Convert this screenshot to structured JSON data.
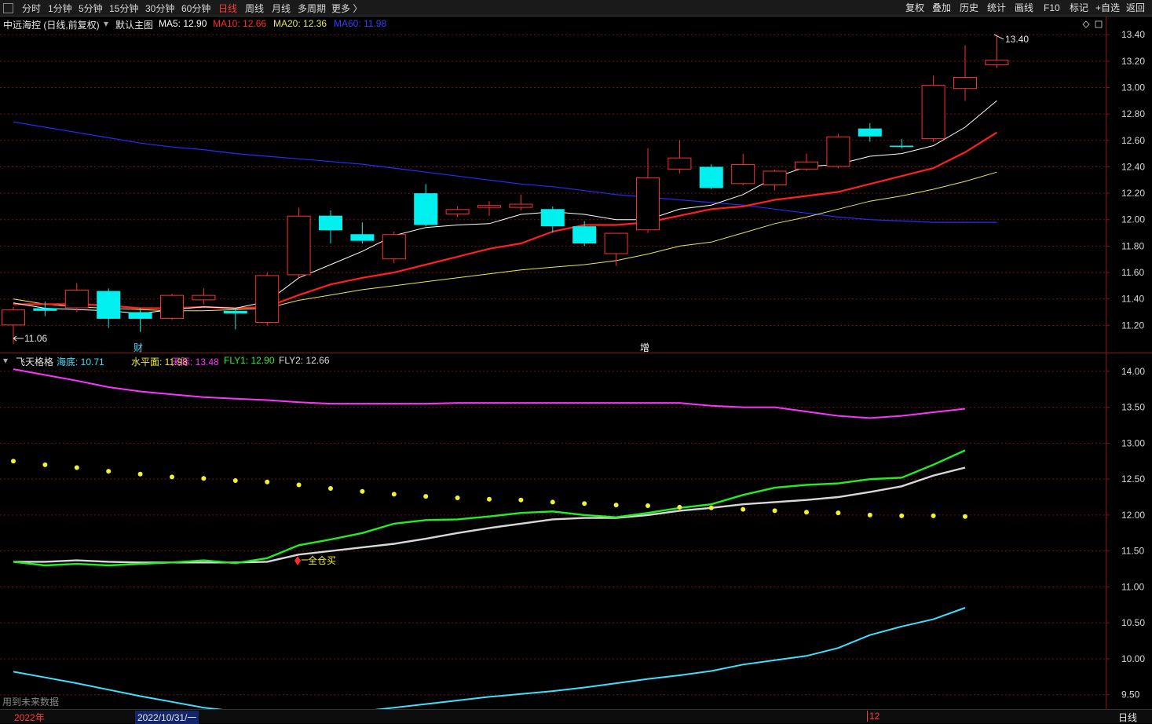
{
  "toolbar": {
    "periods": [
      "分时",
      "1分钟",
      "5分钟",
      "15分钟",
      "30分钟",
      "60分钟",
      "日线",
      "周线",
      "月线",
      "多周期",
      "更多 〉"
    ],
    "active_period": "日线",
    "right_buttons": [
      "复权",
      "叠加",
      "历史",
      "统计",
      "画线",
      "F10",
      "标记",
      "+自选",
      "返回"
    ]
  },
  "main_chart": {
    "stock_title": "中远海控 (日线,前复权)",
    "template_label": "默认主图",
    "ma": [
      {
        "label": "MA5: 12.90",
        "color": "#ffffff"
      },
      {
        "label": "MA10: 12.66",
        "color": "#ff2a2a"
      },
      {
        "label": "MA20: 12.36",
        "color": "#e8e85a"
      },
      {
        "label": "MA60: 11.98",
        "color": "#3b3bff"
      }
    ],
    "y_ticks": [
      "13.40",
      "13.20",
      "13.00",
      "12.80",
      "12.60",
      "12.40",
      "12.20",
      "12.00",
      "11.80",
      "11.60",
      "11.40",
      "11.20"
    ],
    "high_label": "13.40",
    "low_label": "11.06",
    "event_tags": [
      "财",
      "增"
    ]
  },
  "indicator_panel": {
    "name": "飞天格格",
    "values": [
      {
        "label": "海底: 10.71",
        "color": "#3ee0ff"
      },
      {
        "label": "水平面: 11.98",
        "color": "#f2f230"
      },
      {
        "label": "天际: 13.48",
        "color": "#ff33ff"
      },
      {
        "label": "FLY1: 12.90",
        "color": "#33ee33"
      },
      {
        "label": "FLY2: 12.66",
        "color": "#dddddd"
      }
    ],
    "y_ticks": [
      "14.00",
      "13.50",
      "13.00",
      "12.50",
      "12.00",
      "11.50",
      "11.00",
      "10.50",
      "10.00",
      "9.50"
    ],
    "signal_label": "全仓买",
    "footnote": "用到未来数据"
  },
  "bottom_bar": {
    "year": "2022年",
    "date_cursor": "2022/10/31/一",
    "month_mark": "12",
    "period": "日线"
  },
  "chart_data": {
    "type": "candlestick",
    "price_range": [
      11.06,
      13.4
    ],
    "candles": [
      {
        "o": 11.2,
        "c": 11.32,
        "h": 11.34,
        "l": 11.06
      },
      {
        "o": 11.33,
        "c": 11.31,
        "h": 11.38,
        "l": 11.27
      },
      {
        "o": 11.33,
        "c": 11.47,
        "h": 11.52,
        "l": 11.3
      },
      {
        "o": 11.46,
        "c": 11.25,
        "h": 11.48,
        "l": 11.18
      },
      {
        "o": 11.3,
        "c": 11.25,
        "h": 11.33,
        "l": 11.15
      },
      {
        "o": 11.25,
        "c": 11.43,
        "h": 11.44,
        "l": 11.24
      },
      {
        "o": 11.39,
        "c": 11.43,
        "h": 11.48,
        "l": 11.36
      },
      {
        "o": 11.31,
        "c": 11.29,
        "h": 11.33,
        "l": 11.17
      },
      {
        "o": 11.22,
        "c": 11.58,
        "h": 11.6,
        "l": 11.2
      },
      {
        "o": 11.58,
        "c": 12.03,
        "h": 12.09,
        "l": 11.56
      },
      {
        "o": 12.03,
        "c": 11.92,
        "h": 12.07,
        "l": 11.82
      },
      {
        "o": 11.89,
        "c": 11.84,
        "h": 11.98,
        "l": 11.82
      },
      {
        "o": 11.7,
        "c": 11.89,
        "h": 11.91,
        "l": 11.67
      },
      {
        "o": 12.2,
        "c": 11.96,
        "h": 12.27,
        "l": 11.95
      },
      {
        "o": 12.04,
        "c": 12.08,
        "h": 12.1,
        "l": 12.02
      },
      {
        "o": 12.09,
        "c": 12.11,
        "h": 12.14,
        "l": 12.03
      },
      {
        "o": 12.09,
        "c": 12.12,
        "h": 12.19,
        "l": 12.07
      },
      {
        "o": 12.08,
        "c": 11.95,
        "h": 12.1,
        "l": 11.9
      },
      {
        "o": 11.95,
        "c": 11.82,
        "h": 11.99,
        "l": 11.8
      },
      {
        "o": 11.74,
        "c": 11.9,
        "h": 11.9,
        "l": 11.65
      },
      {
        "o": 11.92,
        "c": 12.32,
        "h": 12.54,
        "l": 11.9
      },
      {
        "o": 12.38,
        "c": 12.47,
        "h": 12.6,
        "l": 12.35
      },
      {
        "o": 12.4,
        "c": 12.24,
        "h": 12.42,
        "l": 12.23
      },
      {
        "o": 12.27,
        "c": 12.42,
        "h": 12.5,
        "l": 12.26
      },
      {
        "o": 12.26,
        "c": 12.37,
        "h": 12.38,
        "l": 12.22
      },
      {
        "o": 12.38,
        "c": 12.44,
        "h": 12.5,
        "l": 12.37
      },
      {
        "o": 12.4,
        "c": 12.63,
        "h": 12.65,
        "l": 12.39
      },
      {
        "o": 12.69,
        "c": 12.63,
        "h": 12.73,
        "l": 12.59
      },
      {
        "o": 12.56,
        "c": 12.55,
        "h": 12.61,
        "l": 12.54
      },
      {
        "o": 12.61,
        "c": 13.02,
        "h": 13.09,
        "l": 12.59
      },
      {
        "o": 12.99,
        "c": 13.08,
        "h": 13.32,
        "l": 12.9
      },
      {
        "o": 13.17,
        "c": 13.21,
        "h": 13.4,
        "l": 13.15
      }
    ],
    "ma5": [
      11.37,
      11.33,
      11.32,
      11.31,
      11.29,
      11.32,
      11.34,
      11.33,
      11.38,
      11.56,
      11.66,
      11.76,
      11.88,
      11.94,
      11.96,
      11.97,
      12.04,
      12.06,
      12.04,
      12.0,
      12.0,
      12.08,
      12.11,
      12.19,
      12.32,
      12.4,
      12.42,
      12.48,
      12.5,
      12.56,
      12.7,
      12.9
    ],
    "ma10": [
      11.36,
      11.36,
      11.36,
      11.35,
      11.33,
      11.33,
      11.34,
      11.33,
      11.34,
      11.43,
      11.51,
      11.56,
      11.6,
      11.66,
      11.72,
      11.78,
      11.82,
      11.91,
      11.96,
      11.96,
      11.98,
      12.03,
      12.08,
      12.1,
      12.15,
      12.18,
      12.21,
      12.27,
      12.33,
      12.39,
      12.51,
      12.66
    ],
    "ma20": [
      11.4,
      11.36,
      11.34,
      11.33,
      11.32,
      11.31,
      11.31,
      11.32,
      11.33,
      11.39,
      11.43,
      11.47,
      11.5,
      11.53,
      11.56,
      11.59,
      11.62,
      11.64,
      11.66,
      11.69,
      11.74,
      11.8,
      11.83,
      11.9,
      11.97,
      12.02,
      12.08,
      12.14,
      12.18,
      12.23,
      12.29,
      12.36
    ],
    "ma60": [
      12.74,
      12.7,
      12.66,
      12.62,
      12.58,
      12.55,
      12.53,
      12.5,
      12.48,
      12.46,
      12.44,
      12.42,
      12.39,
      12.36,
      12.33,
      12.3,
      12.27,
      12.25,
      12.22,
      12.19,
      12.17,
      12.15,
      12.13,
      12.11,
      12.08,
      12.05,
      12.02,
      12.0,
      11.99,
      11.98,
      11.98,
      11.98
    ],
    "indicator": {
      "sky": [
        14.03,
        13.95,
        13.87,
        13.78,
        13.72,
        13.68,
        13.64,
        13.62,
        13.6,
        13.57,
        13.55,
        13.55,
        13.55,
        13.55,
        13.56,
        13.56,
        13.56,
        13.56,
        13.56,
        13.56,
        13.56,
        13.56,
        13.52,
        13.5,
        13.5,
        13.44,
        13.38,
        13.35,
        13.38,
        13.43,
        13.48
      ],
      "level": [
        12.75,
        12.7,
        12.66,
        12.61,
        12.57,
        12.53,
        12.51,
        12.48,
        12.46,
        12.42,
        12.37,
        12.33,
        12.29,
        12.26,
        12.24,
        12.22,
        12.21,
        12.18,
        12.16,
        12.14,
        12.13,
        12.11,
        12.1,
        12.08,
        12.06,
        12.04,
        12.03,
        12.0,
        11.99,
        11.99,
        11.98
      ],
      "fly1": [
        11.35,
        11.3,
        11.32,
        11.3,
        11.32,
        11.34,
        11.37,
        11.33,
        11.4,
        11.58,
        11.66,
        11.75,
        11.88,
        11.93,
        11.94,
        11.98,
        12.03,
        12.05,
        12.0,
        11.97,
        12.03,
        12.1,
        12.15,
        12.28,
        12.38,
        12.42,
        12.44,
        12.5,
        12.52,
        12.7,
        12.9
      ],
      "fly2": [
        11.35,
        11.35,
        11.37,
        11.35,
        11.34,
        11.34,
        11.34,
        11.34,
        11.35,
        11.45,
        11.5,
        11.55,
        11.6,
        11.67,
        11.75,
        11.82,
        11.88,
        11.94,
        11.96,
        11.96,
        12.0,
        12.06,
        12.1,
        12.15,
        12.18,
        12.21,
        12.25,
        12.32,
        12.4,
        12.55,
        12.66
      ],
      "sea": [
        9.82,
        9.74,
        9.66,
        9.57,
        9.48,
        9.4,
        9.32,
        9.27,
        9.27,
        9.27,
        9.27,
        9.27,
        9.32,
        9.37,
        9.42,
        9.47,
        9.51,
        9.55,
        9.6,
        9.66,
        9.72,
        9.77,
        9.83,
        9.92,
        9.98,
        10.04,
        10.15,
        10.33,
        10.45,
        10.55,
        10.71
      ]
    }
  }
}
